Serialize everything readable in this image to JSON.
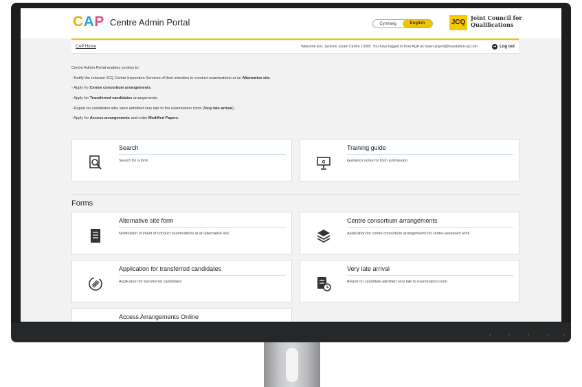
{
  "header": {
    "logo_c": "C",
    "logo_a": "A",
    "logo_p": "P",
    "portal_title": "Centre Admin Portal",
    "lang_options": [
      "Cymraeg",
      "English"
    ],
    "lang_active": "English",
    "jcq_badge": "JCQ",
    "jcq_name": "Joint Council for Qualifications"
  },
  "infobar": {
    "home_link": "CAP Home",
    "welcome": "Welcome Eric Jackson. Exam Centre 10000. You have logged in from AQA as helen.argent@foundation-sp.com",
    "logout": "Log out"
  },
  "intro": {
    "lead": "Centre Admin Portal enables centres to:",
    "lines": [
      [
        "- Notify the relevant JCQ Centre Inspection Services of their intention to conduct examinations at an ",
        "Alternative site",
        "."
      ],
      [
        "- Apply for ",
        "Centre consortium arrangements",
        "."
      ],
      [
        "- Apply for ",
        "Transferred candidates",
        " arrangements."
      ],
      [
        "- Report on candidates who were admitted very late to the examination room (",
        "Very late arrival",
        ")."
      ],
      [
        "- Apply for ",
        "Access arrangements",
        " and order ",
        "Modified Papers",
        "."
      ]
    ]
  },
  "top_cards": [
    {
      "title": "Search",
      "desc": "Search for a form",
      "icon": "search-form-icon"
    },
    {
      "title": "Training guide",
      "desc": "Guidance notes for form submission",
      "icon": "presentation-icon"
    }
  ],
  "forms_heading": "Forms",
  "form_cards": [
    {
      "title": "Alternative site form",
      "desc": "Notification of intent of conduct examinations at an alternative site.",
      "icon": "document-icon"
    },
    {
      "title": "Centre consortium arrangements",
      "desc": "Application for centre consortium arrangements for centre-assessed work",
      "icon": "layers-icon"
    },
    {
      "title": "Application for transferred candidates",
      "desc": "Application for transferred candidates",
      "icon": "transfer-icon"
    },
    {
      "title": "Very late arrival",
      "desc": "Report on candidate admitted very late to examination room.",
      "icon": "late-clock-icon"
    },
    {
      "title": "Access Arrangements Online",
      "desc": "",
      "icon": ""
    }
  ],
  "colors": {
    "accent_yellow": "#f0c400",
    "logo_blue": "#2aa2d5",
    "logo_pink": "#e84c7c",
    "card_rule": "#c6dde8"
  }
}
